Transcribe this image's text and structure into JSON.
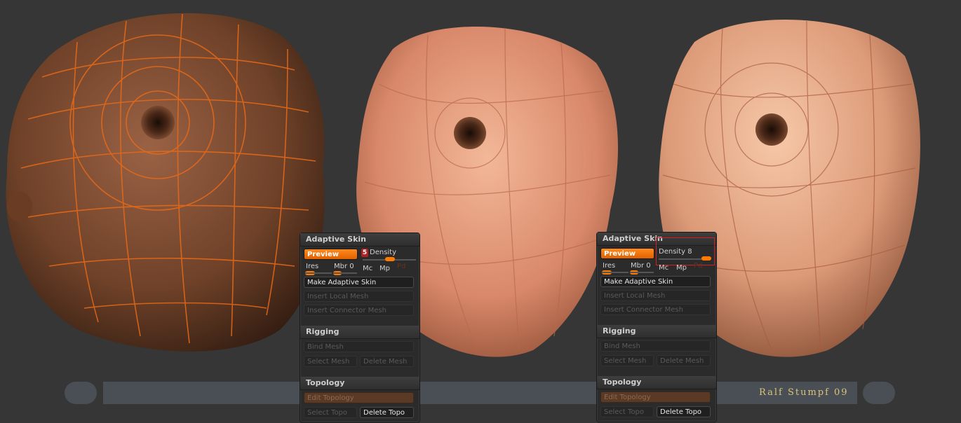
{
  "colors": {
    "background": "#363636",
    "accent": "#ff7a00",
    "highlight": "#d42020",
    "credit": "#d9c47a"
  },
  "panels": [
    {
      "adaptive_skin": {
        "header": "Adaptive Skin",
        "preview": "Preview",
        "density_badge": "5",
        "density": "Density",
        "ires": "Ires",
        "mbr": "Mbr 0",
        "mc": "Mc",
        "mp": "Mp",
        "pd": "Pd",
        "make": "Make Adaptive Skin",
        "insert_local": "Insert Local Mesh",
        "insert_connector": "Insert Connector Mesh"
      },
      "rigging": {
        "header": "Rigging",
        "bind": "Bind Mesh",
        "select": "Select Mesh",
        "delete": "Delete Mesh"
      },
      "topology": {
        "header": "Topology",
        "edit": "Edit Topology",
        "select": "Select Topo",
        "delete": "Delete Topo"
      }
    },
    {
      "adaptive_skin": {
        "header": "Adaptive Skin",
        "preview": "Preview",
        "density": "Density 8",
        "ires": "Ires",
        "mbr": "Mbr 0",
        "mc": "Mc",
        "mp": "Mp",
        "pd": "Pd",
        "make": "Make Adaptive Skin",
        "insert_local": "Insert Local Mesh",
        "insert_connector": "Insert Connector Mesh"
      },
      "rigging": {
        "header": "Rigging",
        "bind": "Bind Mesh",
        "select": "Select Mesh",
        "delete": "Delete Mesh"
      },
      "topology": {
        "header": "Topology",
        "edit": "Edit Topology",
        "select": "Select Topo",
        "delete": "Delete Topo"
      }
    }
  ],
  "credit": "Ralf Stumpf 09"
}
